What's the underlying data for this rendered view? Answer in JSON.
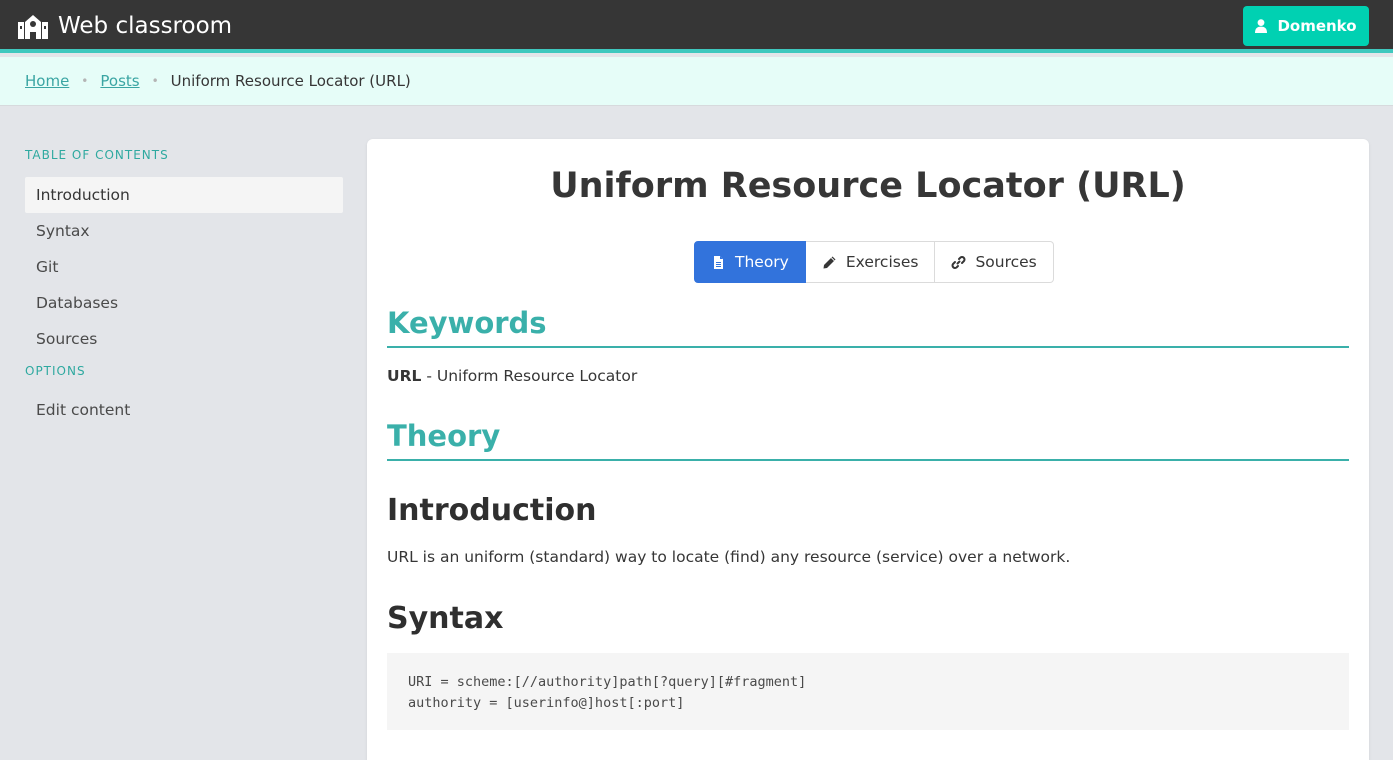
{
  "navbar": {
    "brand": "Web classroom",
    "brand_icon": "school-icon",
    "user_button": "Domenko",
    "user_icon": "user-icon",
    "accent": "#3fc8be",
    "user_button_color": "#00d1b2"
  },
  "breadcrumb": {
    "items": [
      "Home",
      "Posts"
    ],
    "current": "Uniform Resource Locator (URL)"
  },
  "sidebar": {
    "toc_label": "TABLE OF CONTENTS",
    "toc_items": [
      "Introduction",
      "Syntax",
      "Git",
      "Databases",
      "Sources"
    ],
    "toc_active": "Introduction",
    "options_label": "OPTIONS",
    "options_items": [
      "Edit content"
    ]
  },
  "post": {
    "title": "Uniform Resource Locator (URL)",
    "tabs": [
      {
        "label": "Theory",
        "icon": "file-icon",
        "active": true
      },
      {
        "label": "Exercises",
        "icon": "pencil-icon",
        "active": false
      },
      {
        "label": "Sources",
        "icon": "link-icon",
        "active": false
      }
    ],
    "keywords_heading": "Keywords",
    "keyword_term": "URL",
    "keyword_def": " - Uniform Resource Locator",
    "theory_heading": "Theory",
    "intro_heading": "Introduction",
    "intro_text": "URL is an uniform (standard) way to locate (find) any resource (service) over a network.",
    "syntax_heading": "Syntax",
    "syntax_code": "URI = scheme:[//authority]path[?query][#fragment]\nauthority = [userinfo@]host[:port]",
    "heading_color": "#3ab0aa",
    "active_tab_color": "#3273dc"
  }
}
